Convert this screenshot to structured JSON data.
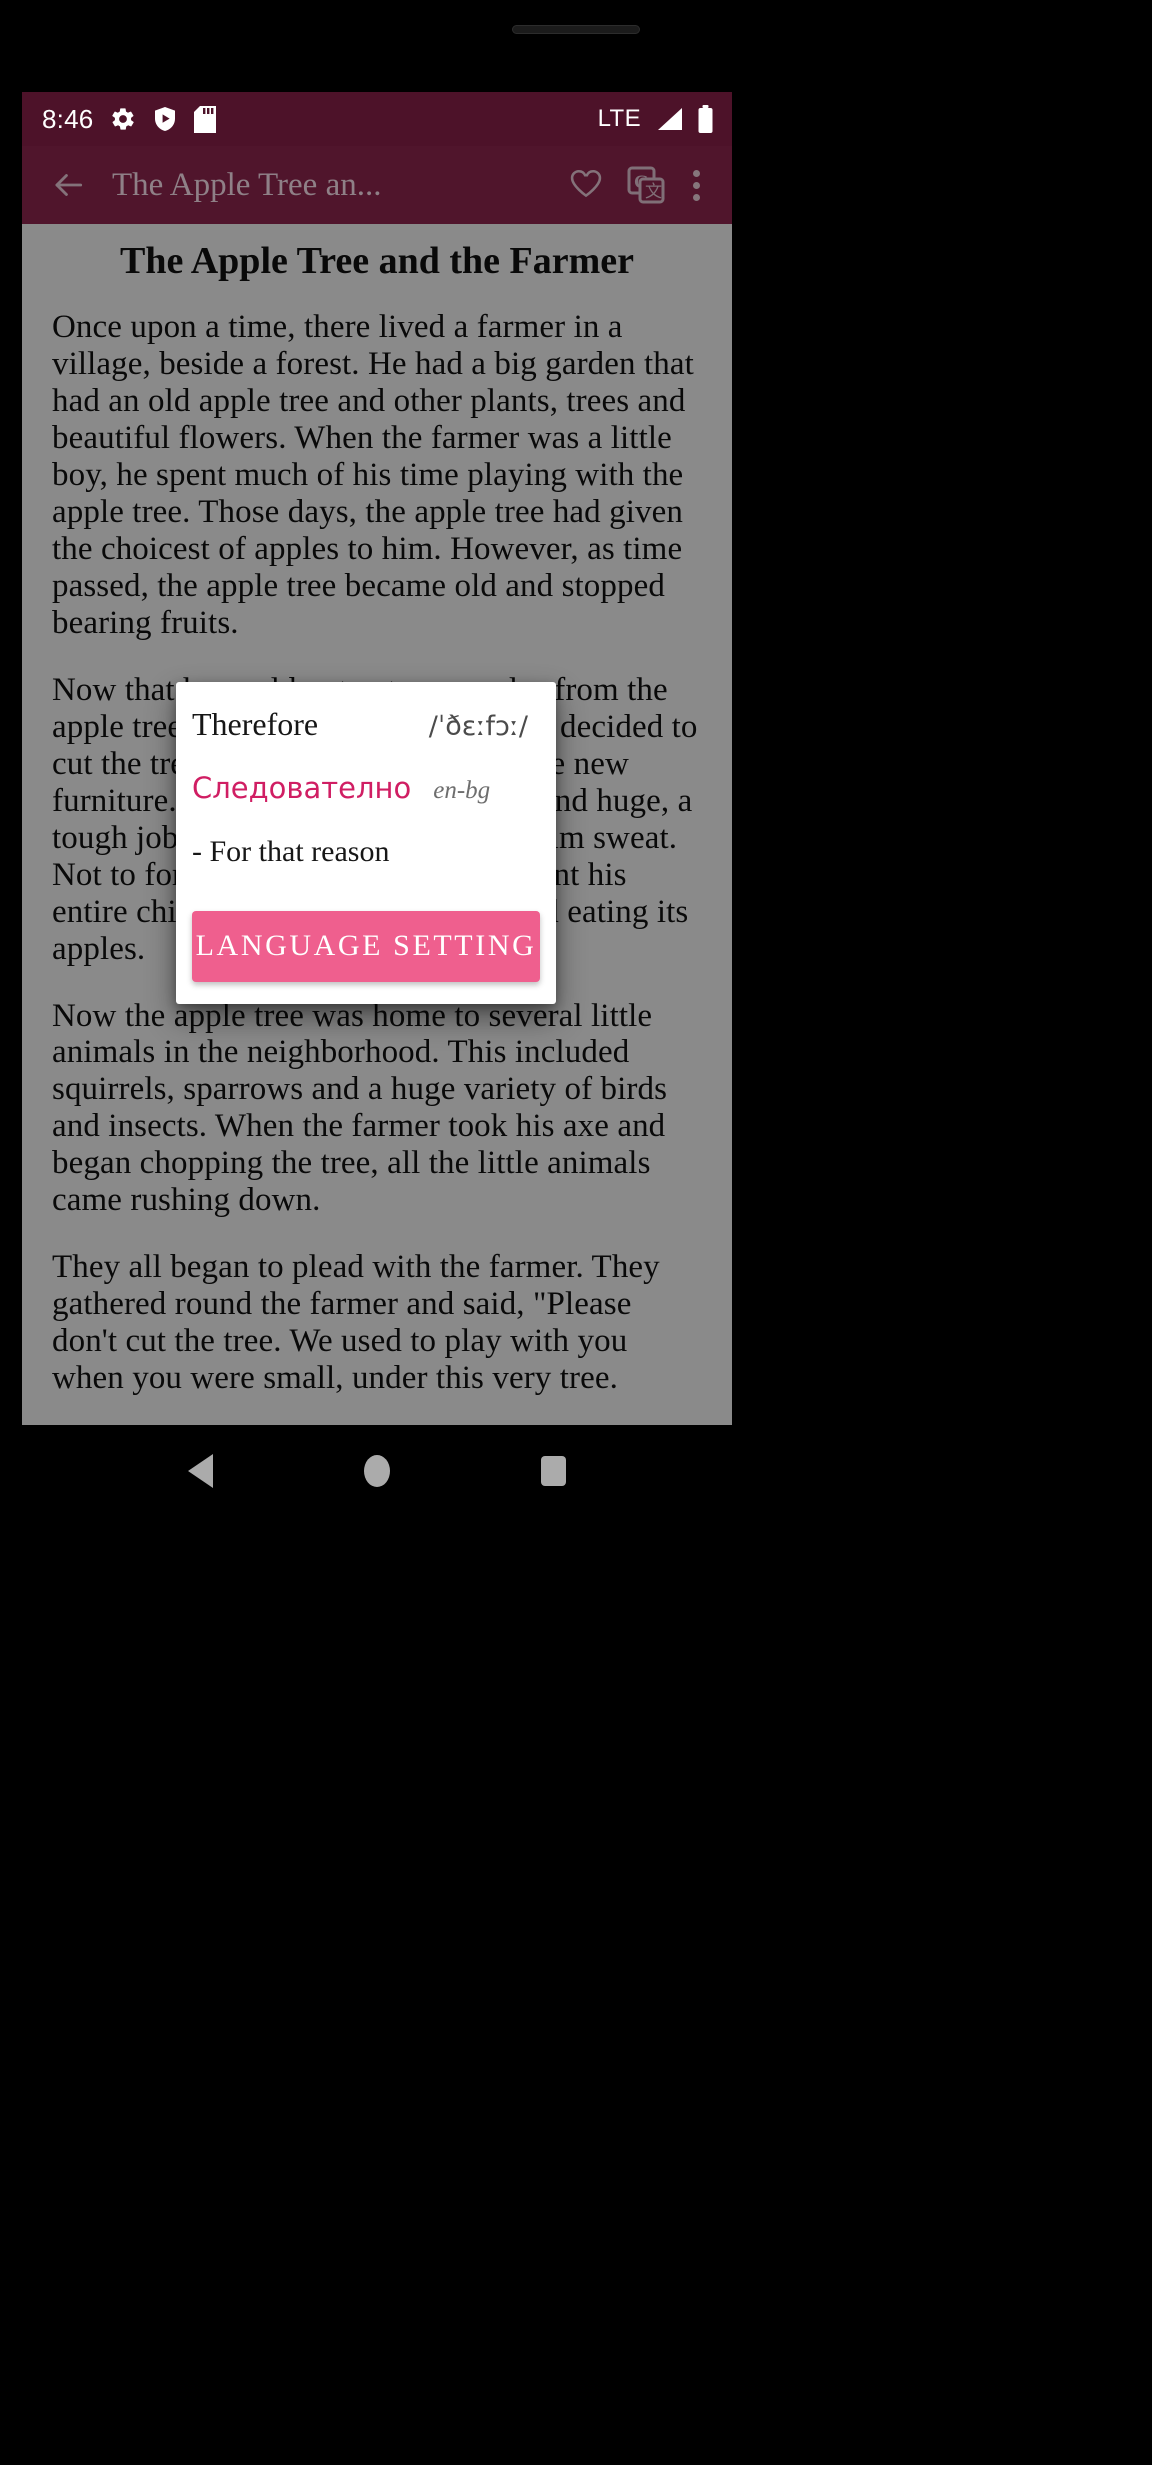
{
  "status_bar": {
    "time": "8:46",
    "icons": [
      "gear-icon",
      "shield-play-icon",
      "sd-card-icon"
    ],
    "network_label": "LTE",
    "right_icons": [
      "signal-icon",
      "battery-icon"
    ],
    "background_color": "#4d1229"
  },
  "app_bar": {
    "back_label": "back-arrow",
    "title": "The Apple Tree an...",
    "actions": [
      "favorite-heart-icon",
      "google-translate-icon",
      "overflow-menu-icon"
    ],
    "background_color": "#7a2144",
    "title_color": "#d9c3cd"
  },
  "story": {
    "title": "The Apple Tree and the Farmer",
    "paragraphs": [
      "Once upon a time, there lived a farmer in a village, beside a forest. He had a big garden that had an old apple tree and other plants, trees and beautiful flowers. When the farmer was a little boy, he spent much of his time playing with the apple tree. Those days, the apple tree had given the choicest of apples to him. However, as time passed, the apple tree became old and stopped bearing fruits.",
      "Now that he could not get any apples from the apple tree, the tree was useless. So he decided to cut the tree and use the wood for some new furniture. However, the tree was old and huge, a tough job to cut, and it would make him sweat. Not to forget that as a boy, he had spent his entire childhood climbing the tree and eating its apples.",
      "Now the apple tree was home to several little animals in the neighborhood. This included squirrels, sparrows and a huge variety of birds and insects. When the farmer took his axe and began chopping the tree, all the little animals came rushing down.",
      "They all began to plead with the farmer. They gathered round the farmer and said, \"Please don't cut the tree. We used to play with you when you were small, under this very tree."
    ]
  },
  "dialog": {
    "headword": "Therefore",
    "phonetic": "/ˈðɛːfɔː/",
    "translation": "Следователно",
    "language_pair": "en-bg",
    "definition": "- For that reason",
    "button_label": "LANGUAGE SETTING",
    "translation_color": "#d01e63",
    "button_color": "#ef5f8e"
  },
  "nav_bar": {
    "buttons": [
      "nav-back-icon",
      "nav-home-icon",
      "nav-recents-icon"
    ]
  }
}
